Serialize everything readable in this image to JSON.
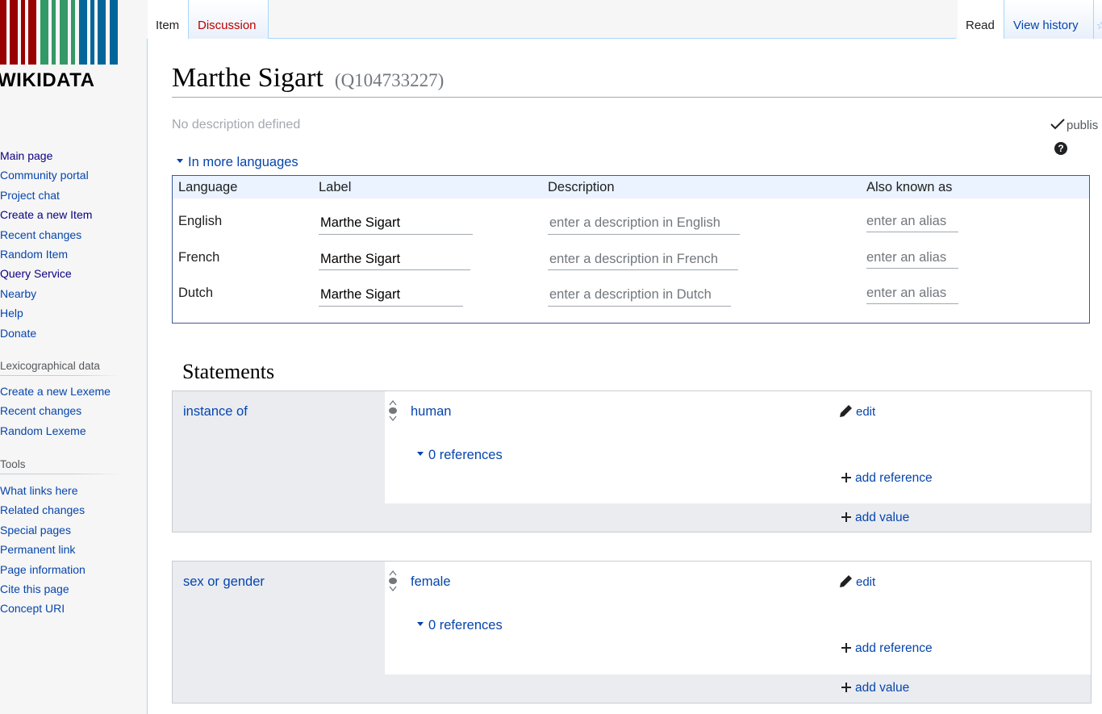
{
  "logo": {
    "text": "WIKIDATA",
    "bar_colors": [
      "#990000",
      "#339966",
      "#006699"
    ]
  },
  "sidebar": {
    "navigation": [
      {
        "label": "Main page",
        "visited": true
      },
      {
        "label": "Community portal",
        "visited": false
      },
      {
        "label": "Project chat",
        "visited": false
      },
      {
        "label": "Create a new Item",
        "visited": true
      },
      {
        "label": "Recent changes",
        "visited": false
      },
      {
        "label": "Random Item",
        "visited": false
      },
      {
        "label": "Query Service",
        "visited": true
      },
      {
        "label": "Nearby",
        "visited": false
      },
      {
        "label": "Help",
        "visited": false
      },
      {
        "label": "Donate",
        "visited": false
      }
    ],
    "lexicographical_heading": "Lexicographical data",
    "lexicographical": [
      "Create a new Lexeme",
      "Recent changes",
      "Random Lexeme"
    ],
    "tools_heading": "Tools",
    "tools": [
      "What links here",
      "Related changes",
      "Special pages",
      "Permanent link",
      "Page information",
      "Cite this page",
      "Concept URI"
    ]
  },
  "tabs": {
    "item": "Item",
    "discussion": "Discussion",
    "read": "Read",
    "view_history": "View history"
  },
  "page": {
    "title": "Marthe Sigart",
    "qid": "(Q104733227)",
    "description": "No description defined",
    "publish_label": "publis",
    "help_icon": "?",
    "more_languages": "In more languages"
  },
  "languages_table": {
    "headers": [
      "Language",
      "Label",
      "Description",
      "Also known as"
    ],
    "rows": [
      {
        "language": "English",
        "label": "Marthe Sigart",
        "description_placeholder": "enter a description in English",
        "alias_placeholder": "enter an alias"
      },
      {
        "language": "French",
        "label": "Marthe Sigart",
        "description_placeholder": "enter a description in French",
        "alias_placeholder": "enter an alias"
      },
      {
        "language": "Dutch",
        "label": "Marthe Sigart",
        "description_placeholder": "enter a description in Dutch",
        "alias_placeholder": "enter an alias"
      }
    ]
  },
  "statements": {
    "heading": "Statements",
    "groups": [
      {
        "property": "instance of",
        "value": "human",
        "edit": "edit",
        "references": "0 references",
        "add_reference": "add reference",
        "add_value": "add value"
      },
      {
        "property": "sex or gender",
        "value": "female",
        "edit": "edit",
        "references": "0 references",
        "add_reference": "add reference",
        "add_value": "add value"
      }
    ]
  }
}
